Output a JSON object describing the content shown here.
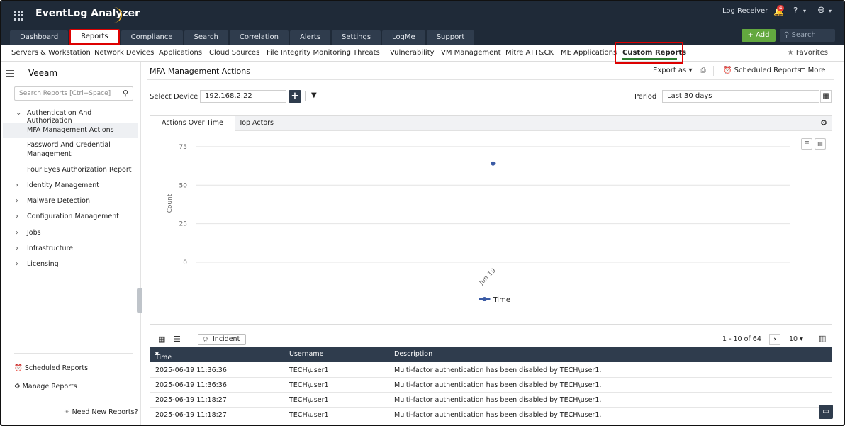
{
  "app": {
    "brand": "EventLog Analyzer",
    "log_receiver": "Log Receiver",
    "notification_count": "4",
    "help_label": "?",
    "add_label": "+ Add",
    "search_placeholder": "Search"
  },
  "nav": {
    "tabs": [
      "Dashboard",
      "Reports",
      "Compliance",
      "Search",
      "Correlation",
      "Alerts",
      "Settings",
      "LogMe",
      "Support"
    ],
    "active": "Reports"
  },
  "subnav": {
    "items": [
      "Servers & Workstation",
      "Network Devices",
      "Applications",
      "Cloud Sources",
      "File Integrity Monitoring",
      "Threats",
      "Vulnerability",
      "VM Management",
      "Mitre ATT&CK",
      "ME Applications",
      "Custom Reports"
    ],
    "active": "Custom Reports",
    "favorites": "Favorites"
  },
  "sidebar": {
    "title": "Veeam",
    "search_placeholder": "Search Reports [Ctrl+Space]",
    "group_open": "Authentication And Authorization",
    "sub_items": [
      "MFA Management Actions",
      "Password And Credential Management",
      "Four Eyes Authorization Report"
    ],
    "groups": [
      "Identity Management",
      "Malware Detection",
      "Configuration Management",
      "Jobs",
      "Infrastructure",
      "Licensing"
    ],
    "scheduled_reports": "Scheduled Reports",
    "manage_reports": "Manage Reports",
    "need_new": "Need New Reports?"
  },
  "main": {
    "page_title": "MFA Management Actions",
    "export_label": "Export as",
    "scheduled_reports": "Scheduled Reports",
    "more": "More",
    "select_device_label": "Select Device",
    "device_value": "192.168.2.22",
    "period_label": "Period",
    "period_value": "Last 30 days",
    "chart_tabs": [
      "Actions Over Time",
      "Top Actors"
    ],
    "incident_label": "Incident",
    "pager_text": "1 - 10 of 64",
    "per_page": "10"
  },
  "table": {
    "columns": [
      "Time",
      "Username",
      "Description"
    ],
    "rows": [
      [
        "2025-06-19 11:36:36",
        "TECH\\user1",
        "Multi-factor authentication has been disabled by TECH\\user1."
      ],
      [
        "2025-06-19 11:36:36",
        "TECH\\user1",
        "Multi-factor authentication has been disabled by TECH\\user1."
      ],
      [
        "2025-06-19 11:18:27",
        "TECH\\user1",
        "Multi-factor authentication has been disabled by TECH\\user1."
      ],
      [
        "2025-06-19 11:18:27",
        "TECH\\user1",
        "Multi-factor authentication has been disabled by TECH\\user1."
      ]
    ]
  },
  "chart_data": {
    "type": "scatter",
    "title": "",
    "xlabel": "",
    "ylabel": "Count",
    "x": [
      "Jun 19"
    ],
    "series": [
      {
        "name": "Time",
        "values": [
          64
        ]
      }
    ],
    "yticks": [
      0,
      25,
      50,
      75
    ],
    "ylim": [
      0,
      80
    ],
    "grid": true,
    "legend": "bottom-center",
    "color": "#3b5ba5"
  }
}
